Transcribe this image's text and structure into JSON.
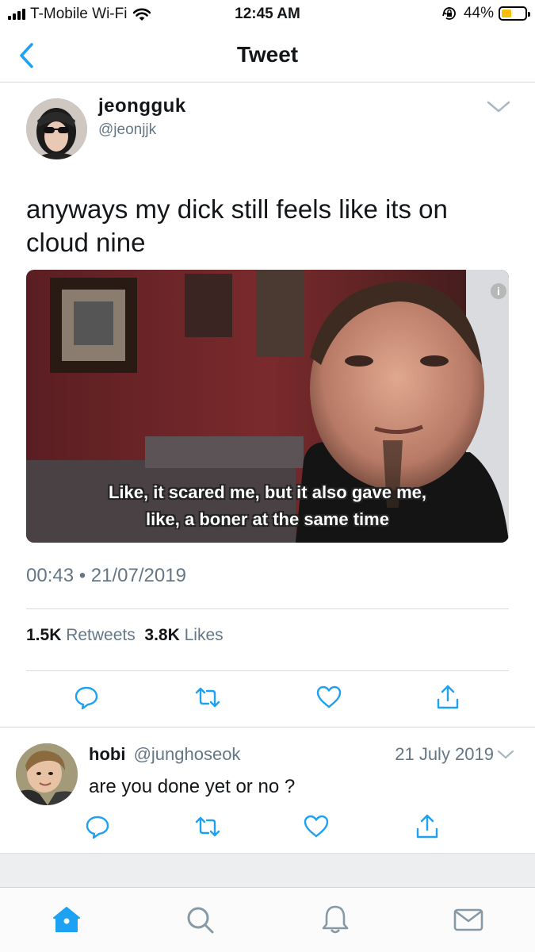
{
  "status_bar": {
    "carrier": "T-Mobile Wi-Fi",
    "time": "12:45 AM",
    "battery_percent": "44%",
    "battery_level": 0.44,
    "battery_color": "#f6c100"
  },
  "nav": {
    "back_icon": "chevron-left-icon",
    "title": "Tweet"
  },
  "tweet": {
    "author_name": "jeongguk",
    "author_handle": "@jeonjjk",
    "text": "anyways my dick still feels like its on cloud nine",
    "media": {
      "info_badge": "i",
      "subtitle_line_1": "Like, it scared me, but it also gave me,",
      "subtitle_line_2": "like, a boner at the same time"
    },
    "timestamp": "00:43 • 21/07/2019",
    "retweets_count": "1.5K",
    "retweets_label": "Retweets",
    "likes_count": "3.8K",
    "likes_label": "Likes",
    "actions": [
      "reply-icon",
      "retweet-icon",
      "like-icon",
      "share-icon"
    ]
  },
  "reply": {
    "author_name": "hobi",
    "author_handle": "@junghoseok",
    "date": "21 July 2019",
    "text": "are you done yet or no ?",
    "actions": [
      "reply-icon",
      "retweet-icon",
      "like-icon",
      "share-icon"
    ]
  },
  "tab_bar": {
    "tabs": [
      "home-icon",
      "search-icon",
      "notifications-icon",
      "messages-icon"
    ],
    "active_color": "#1da1f2"
  },
  "colors": {
    "accent": "#1da1f2",
    "secondary_text": "#657786",
    "primary_text": "#14171a"
  }
}
